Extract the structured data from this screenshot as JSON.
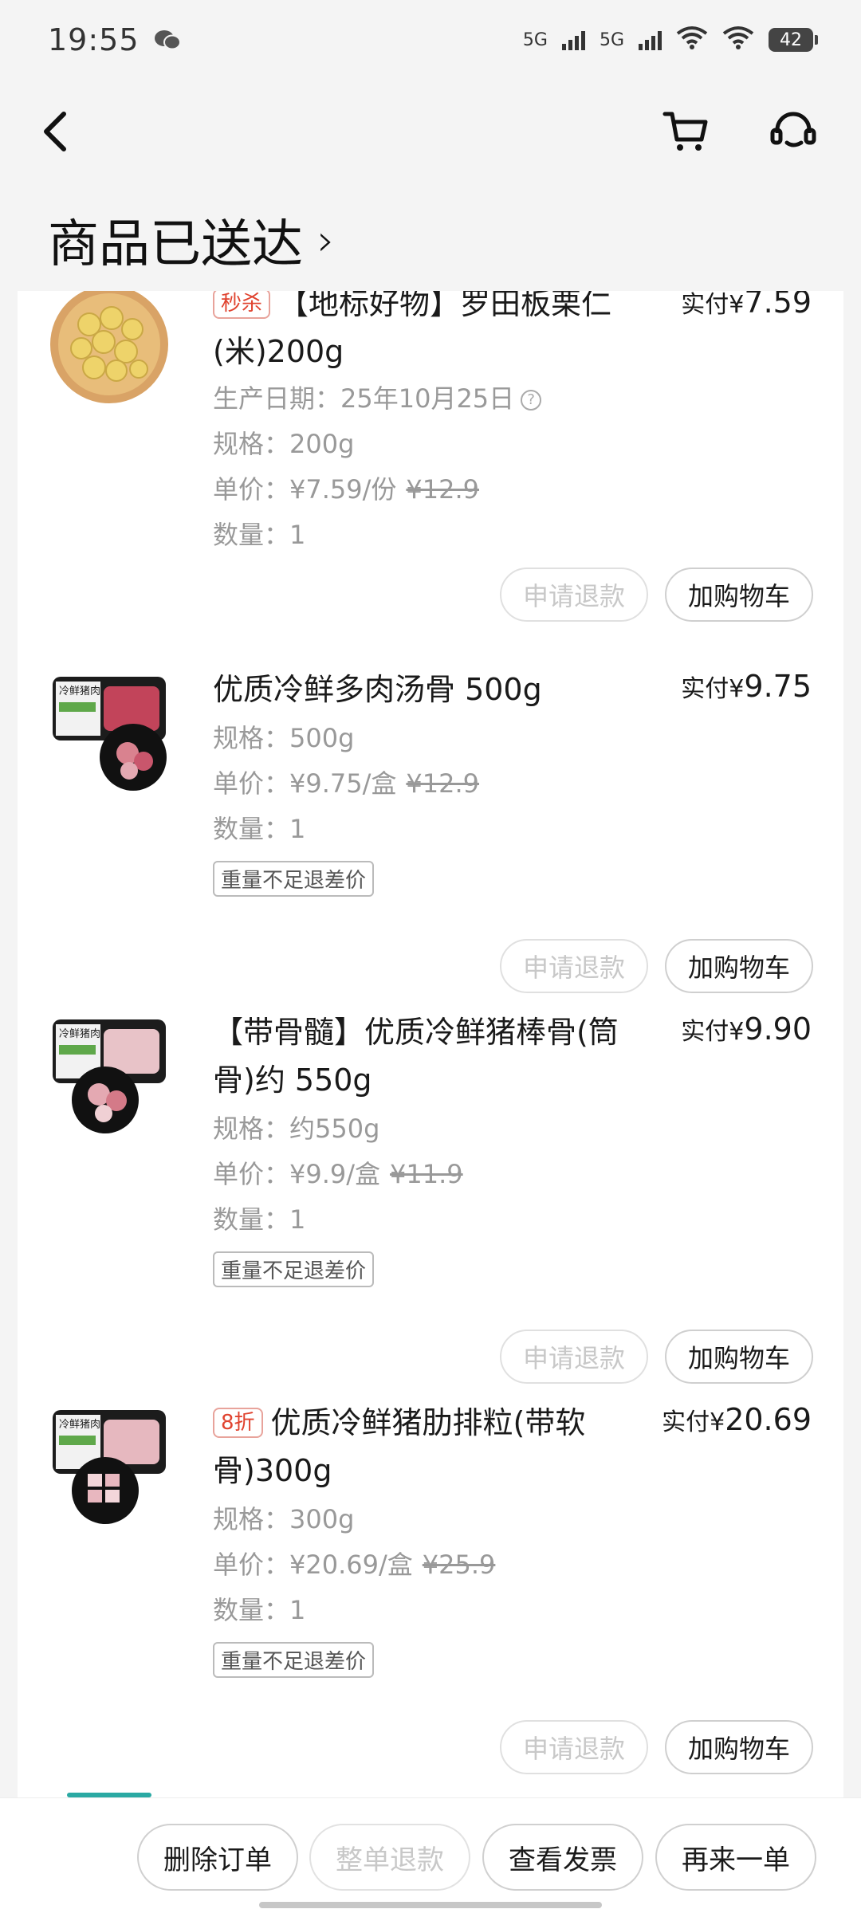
{
  "status_bar": {
    "time": "19:55",
    "net1": "5G",
    "net2": "5G",
    "battery": "42"
  },
  "page": {
    "title": "商品已送达",
    "title_chevron": "›"
  },
  "items": [
    {
      "tag": "秒杀",
      "name": "【地标好物】罗田板栗仁(米)200g",
      "price_prefix": "实付",
      "currency": "¥",
      "price": "7.59",
      "production_date": "生产日期：25年10月25日",
      "spec": "规格：200g",
      "unit_price": "单价：¥7.59/份",
      "original_price": "¥12.9",
      "quantity": "数量：1",
      "refund_label": "申请退款",
      "cart_label": "加购物车"
    },
    {
      "name": "优质冷鲜多肉汤骨 500g",
      "price_prefix": "实付",
      "currency": "¥",
      "price": "9.75",
      "spec": "规格：500g",
      "unit_price": "单价：¥9.75/盒",
      "original_price": "¥12.9",
      "quantity": "数量：1",
      "badge": "重量不足退差价",
      "refund_label": "申请退款",
      "cart_label": "加购物车"
    },
    {
      "name": "【带骨髓】优质冷鲜猪棒骨(筒骨)约 550g",
      "price_prefix": "实付",
      "currency": "¥",
      "price": "9.90",
      "spec": "规格：约550g",
      "unit_price": "单价：¥9.9/盒",
      "original_price": "¥11.9",
      "quantity": "数量：1",
      "badge": "重量不足退差价",
      "refund_label": "申请退款",
      "cart_label": "加购物车"
    },
    {
      "tag": "8折",
      "name": "优质冷鲜猪肋排粒(带软骨)300g",
      "price_prefix": "实付",
      "currency": "¥",
      "price": "20.69",
      "spec": "规格：300g",
      "unit_price": "单价：¥20.69/盒",
      "original_price": "¥25.9",
      "quantity": "数量：1",
      "badge": "重量不足退差价",
      "refund_label": "申请退款",
      "cart_label": "加购物车"
    }
  ],
  "thumb_label": "冷鲜猪肉",
  "bottom_bar": {
    "delete_order": "删除订单",
    "refund_all": "整单退款",
    "view_invoice": "查看发票",
    "reorder": "再来一单"
  },
  "icons": {
    "back": "back-arrow-icon",
    "cart": "cart-icon",
    "service": "customer-service-icon",
    "help": "help-circle-icon"
  },
  "colors": {
    "accent_red": "#e0432f",
    "disabled_text": "#c8c8c8",
    "muted_text": "#999999"
  }
}
